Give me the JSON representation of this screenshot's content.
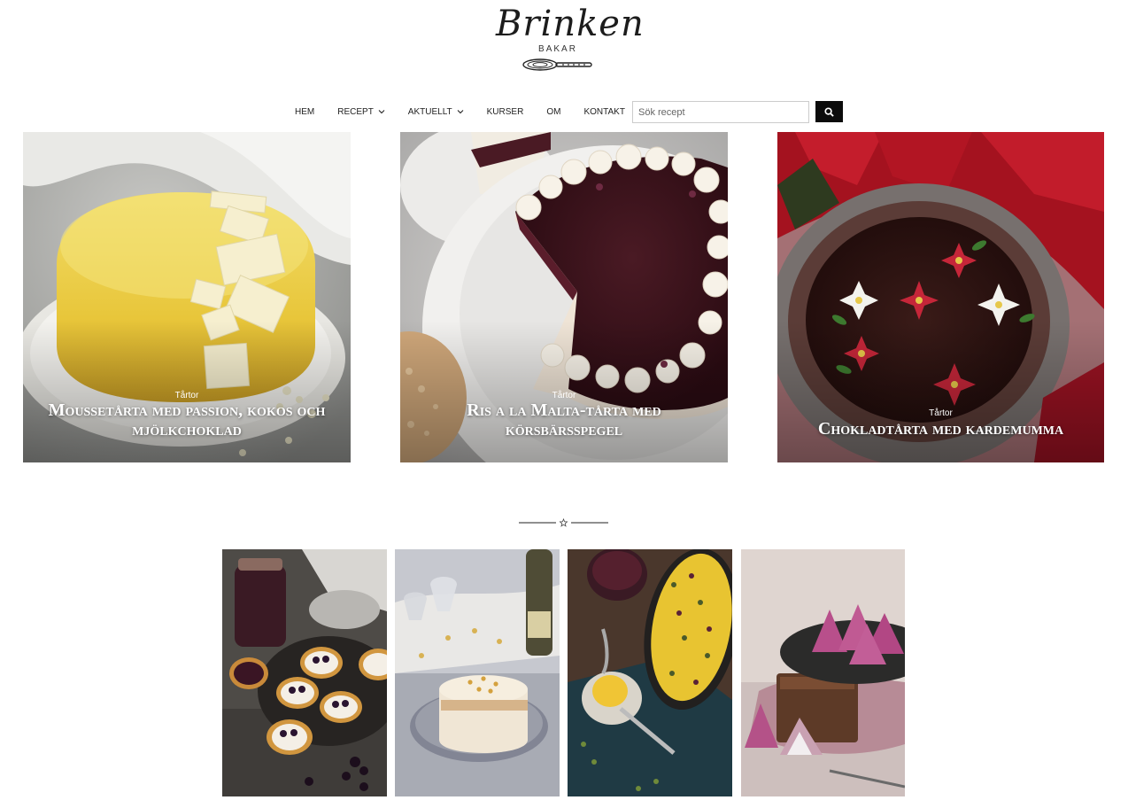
{
  "logo": {
    "script": "Brinken",
    "sub": "BAKAR"
  },
  "nav": {
    "items": [
      {
        "label": "Hem",
        "dropdown": false
      },
      {
        "label": "Recept",
        "dropdown": true
      },
      {
        "label": "Aktuellt",
        "dropdown": true
      },
      {
        "label": "Kurser",
        "dropdown": false
      },
      {
        "label": "Om",
        "dropdown": false
      },
      {
        "label": "Kontakt",
        "dropdown": false
      }
    ]
  },
  "search": {
    "placeholder": "Sök recept",
    "button_icon": "search-icon"
  },
  "featured": [
    {
      "category": "Tårtor",
      "title": "Moussetårta med passion, kokos och mjölkchoklad"
    },
    {
      "category": "Tårtor",
      "title": "Ris a la Malta-tårta med körsbärsspegel"
    },
    {
      "category": "Tårtor",
      "title": "Chokladtårta med kardemumma"
    }
  ],
  "divider_icon": "star-icon",
  "grid": [
    {
      "image": "blueberry-tartlets-photo"
    },
    {
      "image": "mousse-cake-slice-photo"
    },
    {
      "image": "saffron-ice-cream-photo"
    },
    {
      "image": "pink-meringues-photo"
    }
  ],
  "colors": {
    "button_bg": "#0b0b0b",
    "text": "#222222",
    "overlay_text": "#ffffff"
  }
}
